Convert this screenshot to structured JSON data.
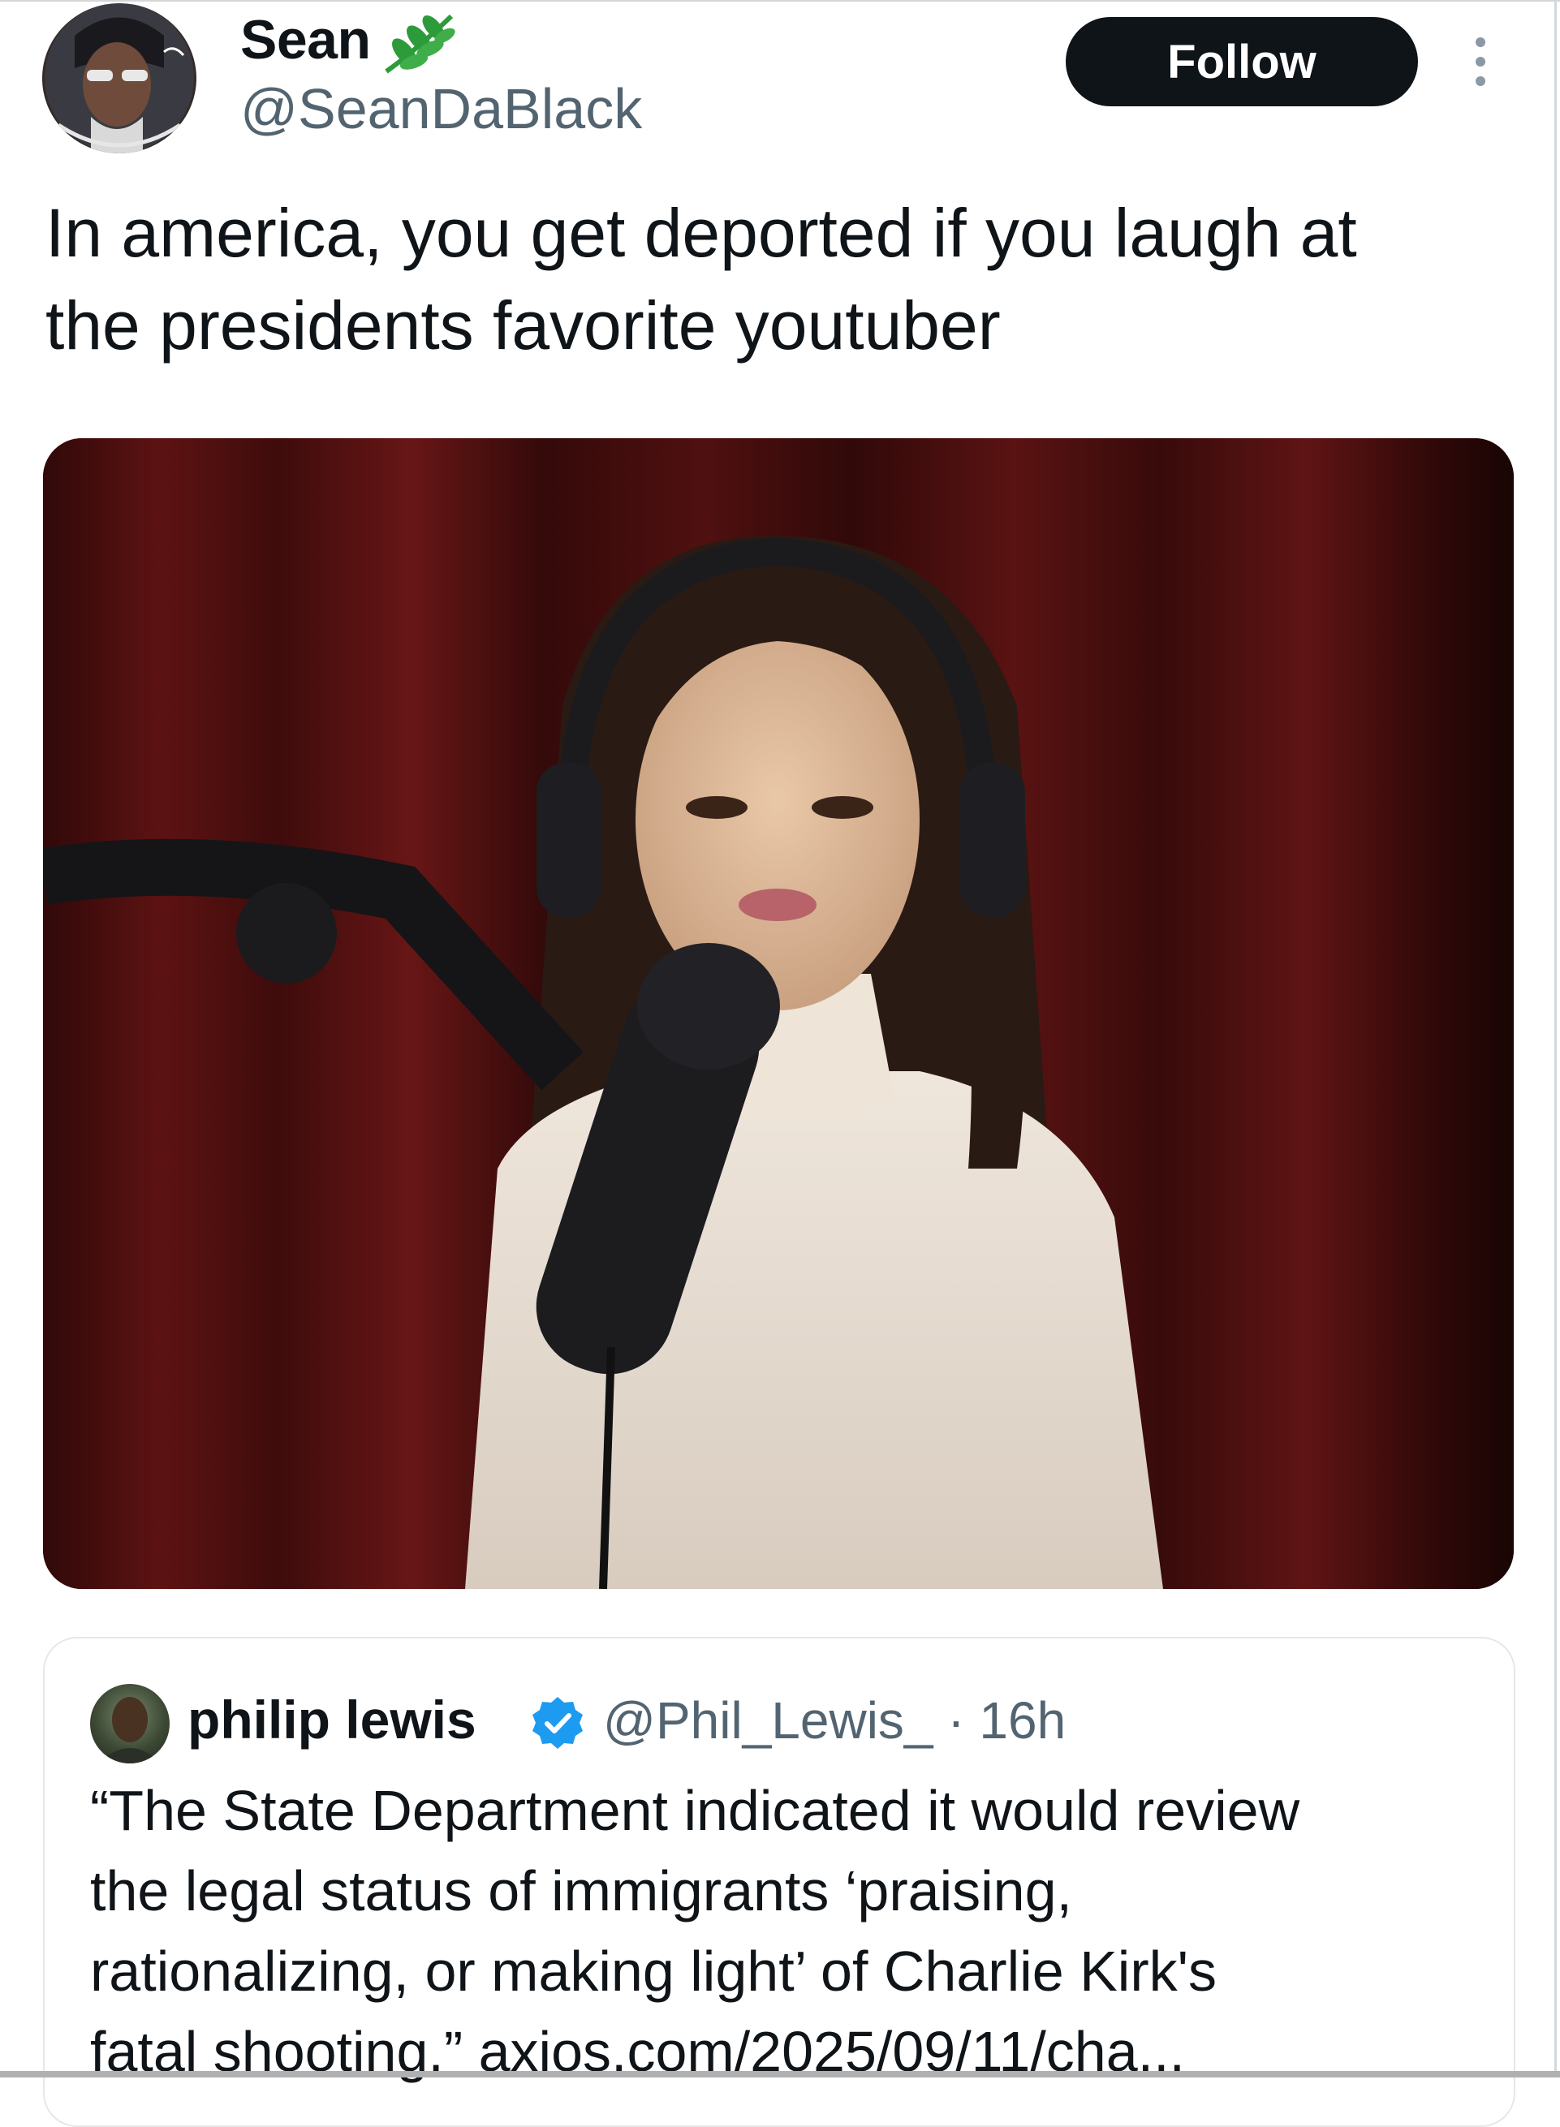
{
  "tweet": {
    "author_name": "Sean",
    "author_handle": "@SeanDaBlack",
    "follow_label": "Follow",
    "text_line1": "In america, you get deported if you laugh at",
    "text_line2": "the presidents favorite youtuber"
  },
  "quoted": {
    "author_name": "philip lewis",
    "author_handle": "@Phil_Lewis_",
    "time": "· 16h",
    "text_lines": [
      "“The State Department indicated it would review",
      "the legal status of immigrants ‘praising,",
      "rationalizing, or making light’ of  Charlie Kirk's",
      "fatal shooting.”"
    ],
    "link": "axios.com/2025/09/11/cha..."
  },
  "icons": {
    "name_badge": "leaf-icon",
    "more": "more-vertical-icon",
    "verified": "verified-badge-icon"
  },
  "colors": {
    "follow_button": "#0f1419",
    "secondary_text": "#536471",
    "verified_blue": "#1d9bf0",
    "leaf_green": "#2e9b3a"
  }
}
